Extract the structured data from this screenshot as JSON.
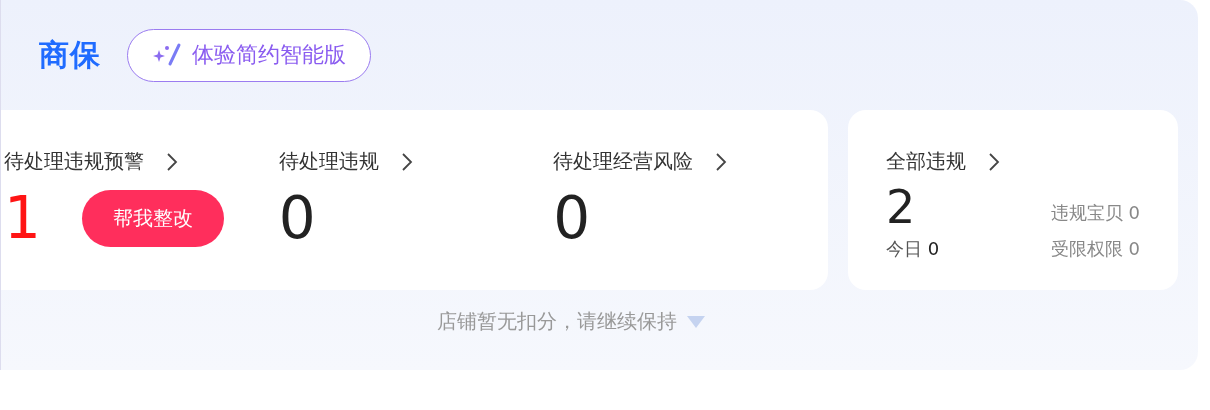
{
  "header": {
    "title": "商保",
    "mode_button": "体验简约智能版"
  },
  "metrics": [
    {
      "label": "待处理违规预警",
      "value": "1",
      "alert": true,
      "action": "帮我整改"
    },
    {
      "label": "待处理违规",
      "value": "0",
      "alert": false
    },
    {
      "label": "待处理经营风险",
      "value": "0",
      "alert": false
    }
  ],
  "summary": {
    "label": "全部违规",
    "value": "2",
    "today_label": "今日",
    "today_value": "0",
    "stats": [
      {
        "label": "违规宝贝",
        "value": "0"
      },
      {
        "label": "受限权限",
        "value": "0"
      }
    ]
  },
  "footer": {
    "text": "店铺暂无扣分，请继续保持"
  }
}
